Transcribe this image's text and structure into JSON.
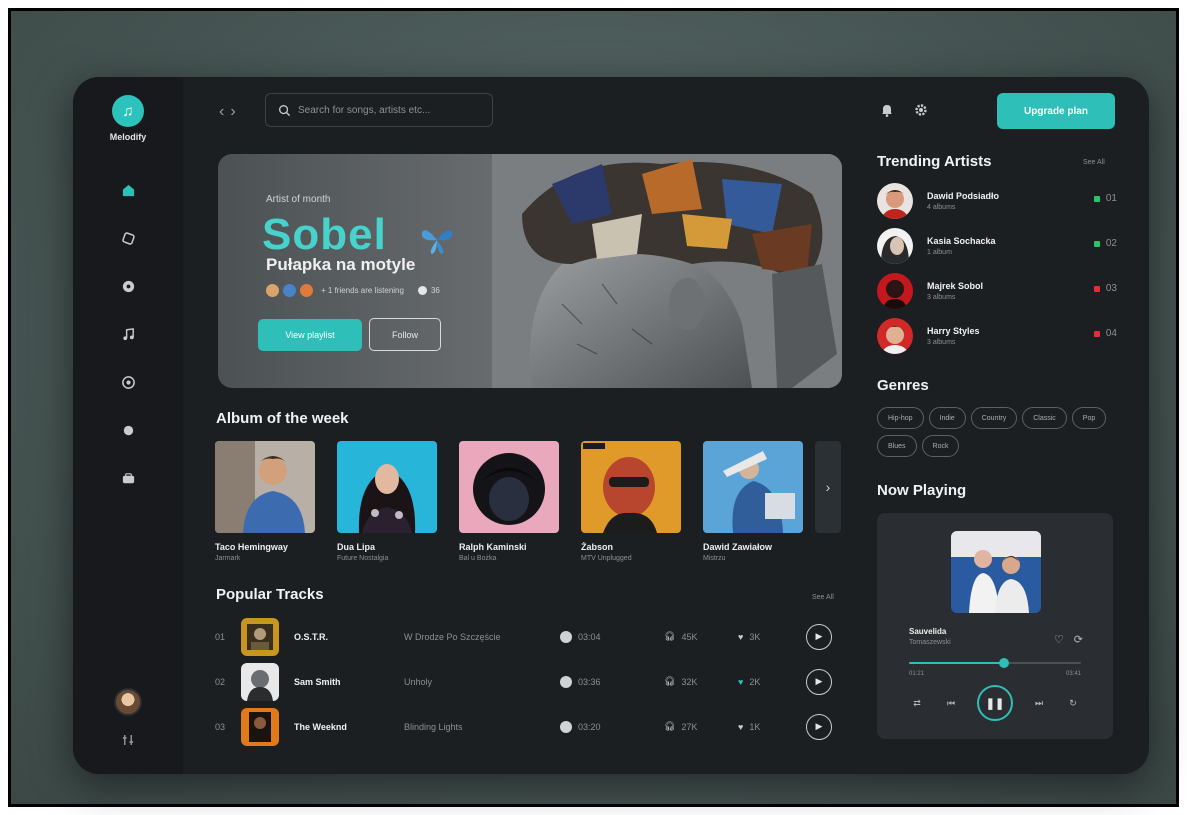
{
  "app": {
    "logo_icon": "music-note-icon",
    "logo_text": "Melodify"
  },
  "colors": {
    "accent": "#2dbfb8",
    "background": "#1c1f22",
    "sidebar": "#17191c",
    "trend_up": "#27c46a",
    "trend_down": "#e02f3a"
  },
  "sidebar": {
    "nav": [
      {
        "name": "home",
        "icon": "home-icon"
      },
      {
        "name": "browse",
        "icon": "compass-icon"
      },
      {
        "name": "albums",
        "icon": "disc-icon"
      },
      {
        "name": "music",
        "icon": "music-icon"
      },
      {
        "name": "radio",
        "icon": "radio-icon"
      },
      {
        "name": "podcast",
        "icon": "podcast-icon"
      },
      {
        "name": "library",
        "icon": "library-icon"
      }
    ],
    "settings_icon": "settings-icon"
  },
  "topbar": {
    "back_icon": "chevron-left-icon",
    "forward_icon": "chevron-right-icon",
    "search_placeholder": "Search for songs, artists etc...",
    "notification_icon": "bell-icon",
    "settings_icon": "gear-icon",
    "upgrade_label": "Upgrade plan"
  },
  "hero": {
    "eyebrow": "Artist of month",
    "title": "Sobel",
    "subtitle": "Pułapka na motyle",
    "meta_text": "+ 1 friends are listening",
    "meta_count": "36",
    "play_label": "View playlist",
    "follow_label": "Follow"
  },
  "albums": {
    "title": "Album of the week",
    "items": [
      {
        "name": "Taco Hemingway",
        "artist": "Jarmark"
      },
      {
        "name": "Dua Lipa",
        "artist": "Future Nostalgia"
      },
      {
        "name": "Ralph Kaminski",
        "artist": "Bal u Bożka"
      },
      {
        "name": "Żabson",
        "artist": "MTV Unplugged"
      },
      {
        "name": "Dawid Zawiałow",
        "artist": "Mistrzu"
      }
    ]
  },
  "tracks": {
    "title": "Popular Tracks",
    "see_all": "See All",
    "items": [
      {
        "num": "01",
        "name": "O.S.T.R.",
        "album": "W Drodze Po Szczęście",
        "duration": "03:04",
        "listens": "45K",
        "likes": "3K",
        "liked": false
      },
      {
        "num": "02",
        "name": "Sam Smith",
        "album": "Unholy",
        "duration": "03:36",
        "listens": "32K",
        "likes": "2K",
        "liked": true
      },
      {
        "num": "03",
        "name": "The Weeknd",
        "album": "Blinding Lights",
        "duration": "03:20",
        "listens": "27K",
        "likes": "1K",
        "liked": false
      }
    ]
  },
  "trending": {
    "title": "Trending Artists",
    "see_all": "See All",
    "items": [
      {
        "name": "Dawid Podsiadło",
        "sub": "4 albums",
        "trend": "up",
        "rank": "01"
      },
      {
        "name": "Kasia Sochacka",
        "sub": "1 album",
        "trend": "up",
        "rank": "02"
      },
      {
        "name": "Majrek Sobol",
        "sub": "3 albums",
        "trend": "down",
        "rank": "03"
      },
      {
        "name": "Harry Styles",
        "sub": "3 albums",
        "trend": "down",
        "rank": "04"
      }
    ]
  },
  "genres": {
    "title": "Genres",
    "items": [
      "Hip-hop",
      "Indie",
      "Country",
      "Classic",
      "Pop",
      "Blues",
      "Rock"
    ]
  },
  "now_playing": {
    "title": "Now Playing",
    "track": "Sauvelida",
    "artist": "Tomaszewski",
    "time_elapsed": "01:21",
    "time_total": "03:41",
    "progress": 0.55,
    "controls": [
      "shuffle-icon",
      "previous-icon",
      "pause-icon",
      "next-icon",
      "repeat-icon"
    ]
  }
}
